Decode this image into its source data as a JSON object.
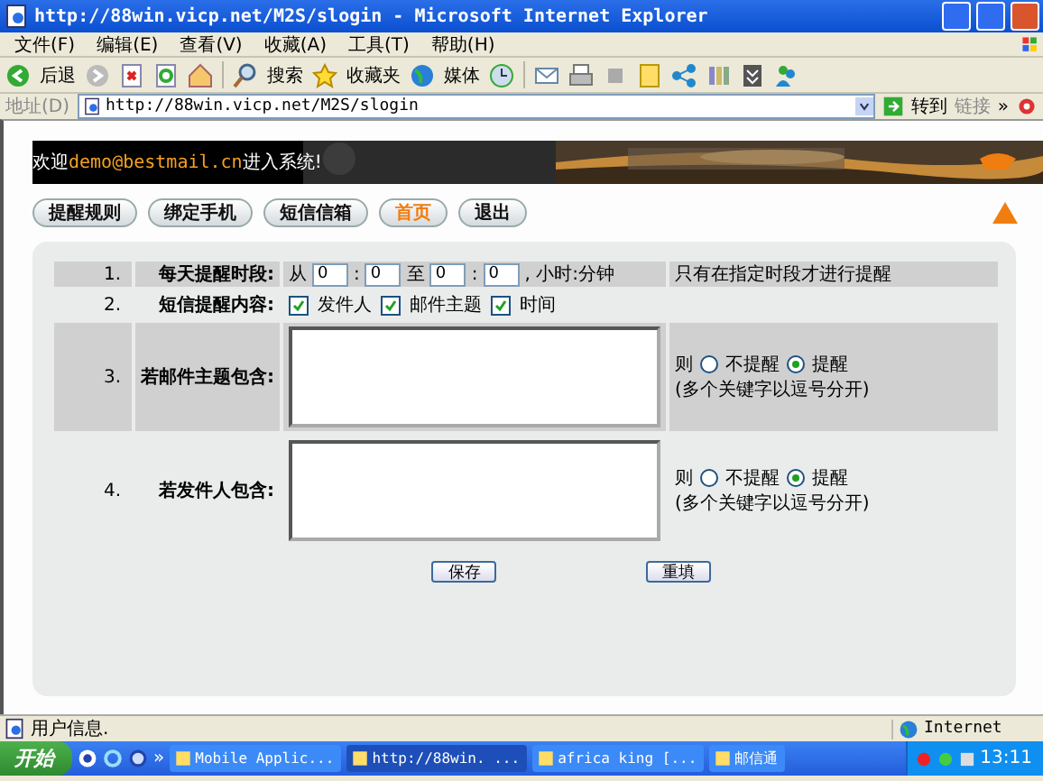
{
  "window": {
    "title": "http://88win.vicp.net/M2S/slogin - Microsoft Internet Explorer"
  },
  "menu": [
    "文件(F)",
    "编辑(E)",
    "查看(V)",
    "收藏(A)",
    "工具(T)",
    "帮助(H)"
  ],
  "toolbar": {
    "back": "后退",
    "search": "搜索",
    "favorites": "收藏夹",
    "media": "媒体"
  },
  "address_bar": {
    "label": "地址(D)",
    "url": "http://88win.vicp.net/M2S/slogin",
    "go": "转到",
    "links": "链接",
    "more": "»"
  },
  "banner": {
    "welcome_prefix": "欢迎",
    "email": "demo@bestmail.cn",
    "welcome_suffix": "进入系统!"
  },
  "nav": [
    {
      "label": "提醒规则",
      "selected": false
    },
    {
      "label": "绑定手机",
      "selected": false
    },
    {
      "label": "短信信箱",
      "selected": false
    },
    {
      "label": "首页",
      "selected": true
    },
    {
      "label": "退出",
      "selected": false
    }
  ],
  "rules": [
    {
      "kind": "time",
      "index": "1.",
      "label": "每天提醒时段:",
      "from": "从",
      "start_hour": "0",
      "separator": ":",
      "start_minute": "0",
      "to": "至",
      "end_hour": "0",
      "end_separator": ":",
      "end_minute": "0",
      "unit": ", 小时:分钟",
      "note": "只有在指定时段才进行提醒"
    },
    {
      "kind": "checks",
      "index": "2.",
      "label": "短信提醒内容:",
      "options": [
        {
          "label": "发件人",
          "checked": true
        },
        {
          "label": "邮件主题",
          "checked": true
        },
        {
          "label": "时间",
          "checked": true
        }
      ]
    },
    {
      "kind": "keywords",
      "index": "3.",
      "label": "若邮件主题包含:",
      "then": "则",
      "choices": [
        {
          "label": "不提醒",
          "selected": false
        },
        {
          "label": "提醒",
          "selected": true
        }
      ],
      "hint": "(多个关键字以逗号分开)"
    },
    {
      "kind": "keywords",
      "index": "4.",
      "label": "若发件人包含:",
      "then": "则",
      "choices": [
        {
          "label": "不提醒",
          "selected": false
        },
        {
          "label": "提醒",
          "selected": true
        }
      ],
      "hint": "(多个关键字以逗号分开)"
    }
  ],
  "actions": [
    "保存",
    "重填"
  ],
  "status_bar": {
    "text": "用户信息.",
    "zone": "Internet"
  },
  "taskbar": {
    "start": "开始",
    "more": "»",
    "tasks": [
      {
        "label": "Mobile Applic...",
        "selected": false
      },
      {
        "label": "http://88win. ...",
        "selected": true
      },
      {
        "label": "africa king [...",
        "selected": false
      },
      {
        "label": "邮信通",
        "selected": false
      }
    ],
    "clock": "13:11"
  }
}
